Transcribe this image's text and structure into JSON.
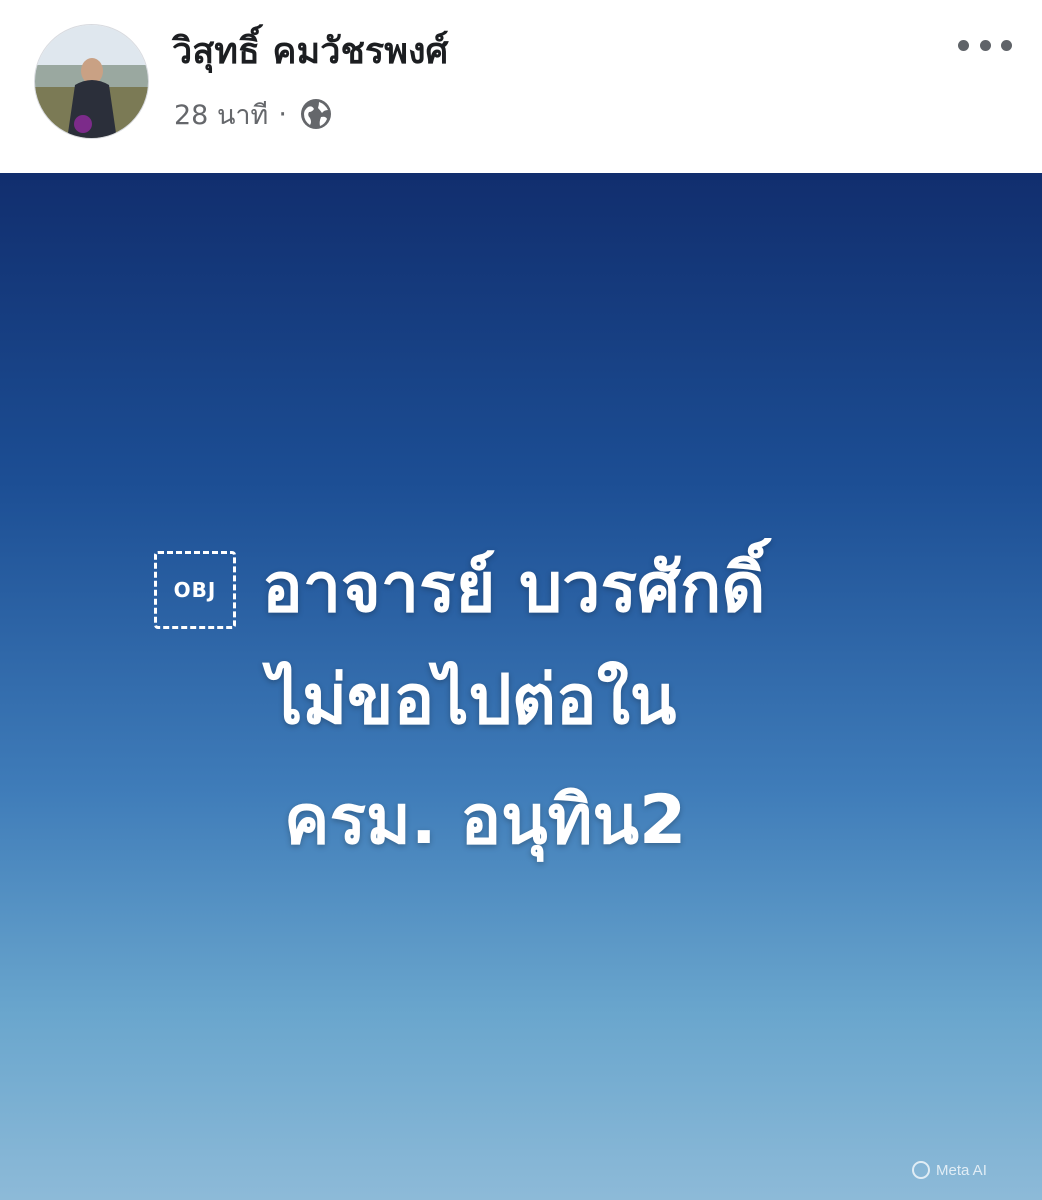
{
  "post": {
    "author_name": "วิสุทธิ์ คมวัชรพงศ์",
    "time": "28 นาที",
    "separator": "·",
    "privacy_icon": "globe-icon",
    "more_icon": "more-options-icon",
    "avatar_icon": "profile-photo"
  },
  "card": {
    "obj_placeholder": "OBJ",
    "lines": [
      "อาจารย์ บวรศักดิ์",
      "ไม่ขอไปต่อใน",
      "ครม. อนุทิน2"
    ],
    "watermark": "Meta AI"
  },
  "colors": {
    "card_top": "#112e6e",
    "card_bottom": "#8dbad8",
    "meta_gray": "#65676b"
  }
}
